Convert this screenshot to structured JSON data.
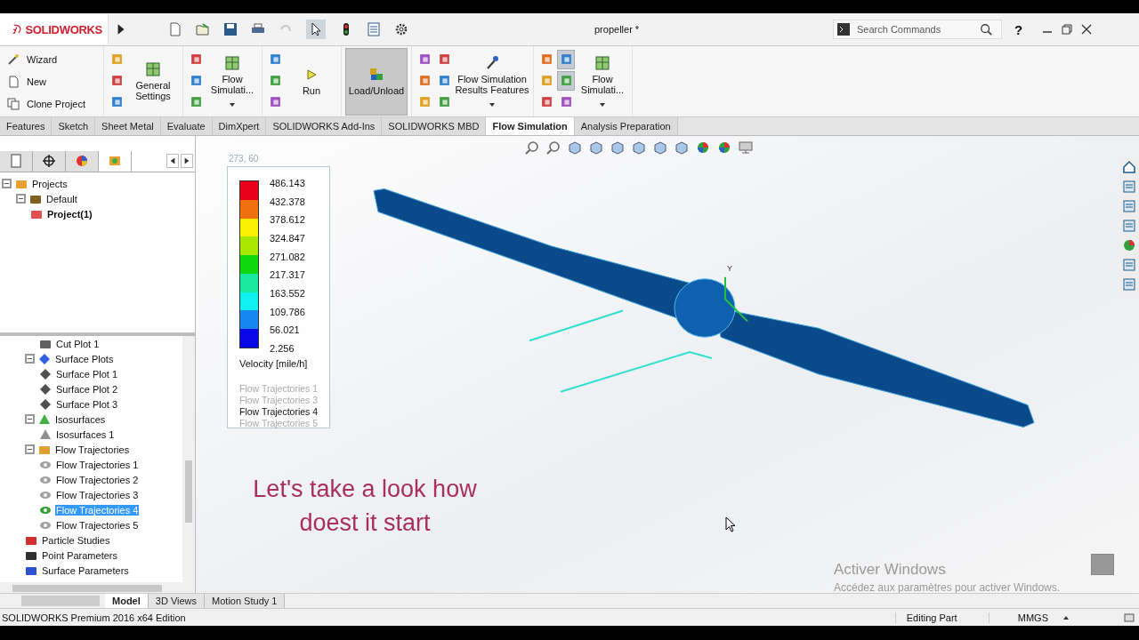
{
  "app": {
    "logo_text": "SOLIDWORKS",
    "document_title": "propeller *",
    "search": {
      "placeholder": "Search Commands"
    },
    "help": "?"
  },
  "ribbon": {
    "list_buttons": [
      {
        "label": "Wizard"
      },
      {
        "label": "New"
      },
      {
        "label": "Clone Project"
      }
    ],
    "groups": [
      {
        "label": "General Settings",
        "small_buttons": [
          {
            "pressed": false
          },
          {
            "pressed": false
          },
          {
            "pressed": false
          }
        ]
      },
      {
        "label": "Flow Simulati...",
        "caret": true,
        "small_buttons": [
          {
            "pressed": false
          },
          {
            "pressed": false
          },
          {
            "pressed": false
          }
        ]
      },
      {
        "label": "Run",
        "small_buttons": [
          {
            "pressed": false
          },
          {
            "pressed": false
          },
          {
            "pressed": false
          }
        ]
      },
      {
        "label": "Load/Unload",
        "pressed": true
      },
      {
        "label": "Flow Simulation Results Features",
        "caret": true,
        "small_buttons": [
          {
            "pressed": false
          },
          {
            "pressed": false
          },
          {
            "pressed": false
          },
          {
            "pressed": false
          },
          {
            "pressed": false
          },
          {
            "pressed": false
          }
        ]
      },
      {
        "label": "Flow Simulati...",
        "caret": true,
        "small_buttons": [
          {
            "pressed": false
          },
          {
            "pressed": false
          },
          {
            "pressed": false
          },
          {
            "pressed": true
          },
          {
            "pressed": true
          },
          {
            "pressed": false
          }
        ]
      }
    ]
  },
  "tabs": [
    {
      "label": "Features",
      "selected": false
    },
    {
      "label": "Sketch",
      "selected": false
    },
    {
      "label": "Sheet Metal",
      "selected": false
    },
    {
      "label": "Evaluate",
      "selected": false
    },
    {
      "label": "DimXpert",
      "selected": false
    },
    {
      "label": "SOLIDWORKS Add-Ins",
      "selected": false
    },
    {
      "label": "SOLIDWORKS MBD",
      "selected": false
    },
    {
      "label": "Flow Simulation",
      "selected": true
    },
    {
      "label": "Analysis Preparation",
      "selected": false
    }
  ],
  "left_panel": {
    "tabs": [
      {
        "selected": false
      },
      {
        "selected": false
      },
      {
        "selected": false
      },
      {
        "selected": true
      }
    ],
    "project_tree": [
      {
        "label": "Projects",
        "kind": "projects",
        "expanded": true,
        "children": [
          {
            "label": "Default",
            "kind": "config",
            "expanded": true,
            "children": [
              {
                "label": "Project(1)",
                "kind": "project",
                "bold": true
              }
            ]
          }
        ]
      }
    ],
    "results_tree": {
      "continued": [
        {
          "label": "Cut Plot 1",
          "kind": "cut-plot",
          "selected": false
        }
      ],
      "items": [
        {
          "label": "Surface Plots",
          "kind": "surface-group",
          "expanded": true,
          "selected": false,
          "children": [
            {
              "label": "Surface Plot 1",
              "kind": "surface",
              "selected": false
            },
            {
              "label": "Surface Plot 2",
              "kind": "surface",
              "selected": false
            },
            {
              "label": "Surface Plot 3",
              "kind": "surface",
              "selected": false
            }
          ]
        },
        {
          "label": "Isosurfaces",
          "kind": "iso-group",
          "expanded": true,
          "selected": false,
          "children": [
            {
              "label": "Isosurfaces 1",
              "kind": "iso",
              "selected": false
            }
          ]
        },
        {
          "label": "Flow Trajectories",
          "kind": "traj-group",
          "expanded": true,
          "selected": false,
          "children": [
            {
              "label": "Flow Trajectories 1",
              "kind": "traj",
              "selected": false
            },
            {
              "label": "Flow Trajectories 2",
              "kind": "traj",
              "selected": false
            },
            {
              "label": "Flow Trajectories 3",
              "kind": "traj",
              "selected": false
            },
            {
              "label": "Flow Trajectories 4",
              "kind": "traj-active",
              "selected": true
            },
            {
              "label": "Flow Trajectories 5",
              "kind": "traj",
              "selected": false
            }
          ]
        },
        {
          "label": "Particle Studies",
          "kind": "particles",
          "selected": false
        },
        {
          "label": "Point Parameters",
          "kind": "point",
          "selected": false
        },
        {
          "label": "Surface Parameters",
          "kind": "surface-param",
          "selected": false
        }
      ]
    }
  },
  "viewport": {
    "cursor_readout": "273, 60",
    "legend": {
      "labels": [
        "486.143",
        "432.378",
        "378.612",
        "324.847",
        "271.082",
        "217.317",
        "163.552",
        "109.786",
        "56.021",
        "2.256"
      ],
      "bands": [
        {
          "color": "#e8001a"
        },
        {
          "color": "#f07010"
        },
        {
          "color": "#f8f000"
        },
        {
          "color": "#a8e800"
        },
        {
          "color": "#10d810"
        },
        {
          "color": "#18e8a0"
        },
        {
          "color": "#10f0f0"
        },
        {
          "color": "#1888f0"
        },
        {
          "color": "#0808e8"
        }
      ],
      "quantity": "Velocity [mile/h]",
      "trajectories": [
        {
          "label": "Flow Trajectories 1",
          "selected": false
        },
        {
          "label": "Flow Trajectories 3",
          "selected": false
        },
        {
          "label": "Flow Trajectories 4",
          "selected": true
        },
        {
          "label": "Flow Trajectories 5",
          "selected": false
        }
      ]
    },
    "caption": [
      "Let's take a look how",
      "doest it start"
    ],
    "axis_label": "Y",
    "activation": {
      "title": "Activer Windows",
      "hint": "Accédez aux paramètres pour activer Windows."
    }
  },
  "bottom_tabs": [
    {
      "label": "Model",
      "selected": true
    },
    {
      "label": "3D Views",
      "selected": false
    },
    {
      "label": "Motion Study 1",
      "selected": false
    }
  ],
  "status_bar": {
    "edition": "SOLIDWORKS Premium 2016 x64 Edition",
    "mode": "Editing Part",
    "units": "MMGS"
  }
}
